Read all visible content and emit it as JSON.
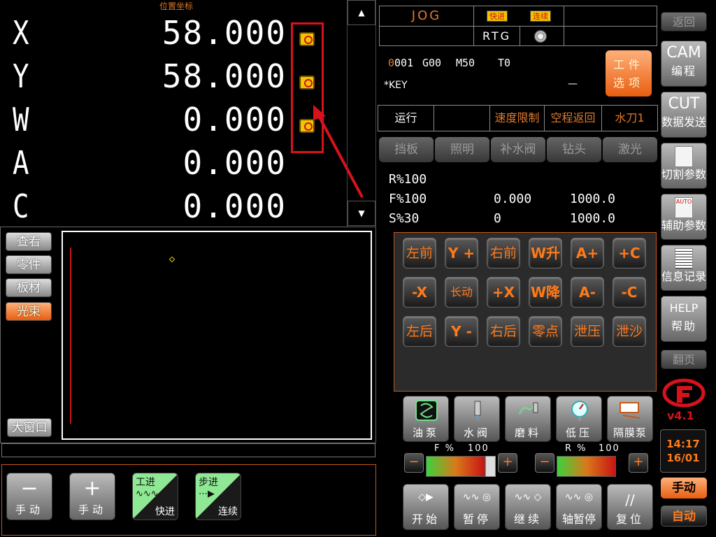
{
  "position": {
    "title": "位置坐标",
    "axes": [
      {
        "label": "X",
        "value": "58.000"
      },
      {
        "label": "Y",
        "value": "58.000"
      },
      {
        "label": "W",
        "value": "0.000"
      },
      {
        "label": "A",
        "value": "0.000"
      },
      {
        "label": "C",
        "value": "0.000"
      }
    ]
  },
  "scroll": {
    "up": "▲",
    "down": "▼"
  },
  "view_buttons": [
    "查看",
    "零件",
    "板材",
    "光束"
  ],
  "large_window": "大窗口",
  "bottom_buttons": {
    "minus_sym": "−",
    "minus_label": "手动",
    "plus_sym": "+",
    "plus_label": "手动",
    "feed_top": "工进",
    "feed_bottom": "快进",
    "step_top": "步进",
    "step_bottom": "连续"
  },
  "status": {
    "mode": "JOG",
    "tag_fast": "快进",
    "tag_continuous": "连续",
    "rtg": "RTG",
    "codes": {
      "n": "001",
      "g": "G00",
      "m": "M50",
      "t": "T0"
    },
    "key": "*KEY",
    "dash": "—"
  },
  "work_options": {
    "line1": "工件",
    "line2": "选项"
  },
  "run_row": [
    "运行",
    "",
    "速度限制",
    "空程返回",
    "水刀1"
  ],
  "gray_buttons": [
    "挡板",
    "照明",
    "补水阀",
    "钻头",
    "激光"
  ],
  "overrides": {
    "r": "R%100",
    "f": "F%100",
    "s": "S%30",
    "f_val1": "0.000",
    "f_val2": "1000.0",
    "s_val1": "0",
    "s_val2": "1000.0"
  },
  "jog_rows": [
    [
      "左前",
      "Y +",
      "右前",
      "W升",
      "A+",
      "+C"
    ],
    [
      "-X",
      "长动",
      "+X",
      "W降",
      "A-",
      "-C"
    ],
    [
      "左后",
      "Y -",
      "右后",
      "零点",
      "泄压",
      "泄沙"
    ]
  ],
  "function_buttons": [
    "油泵",
    "水阀",
    "磨料",
    "低压",
    "隔膜泵"
  ],
  "feed_override": {
    "label": "F %",
    "value": "100",
    "level": 0.85
  },
  "rapid_override": {
    "label": "R %",
    "value": "100",
    "level": 0.85
  },
  "control_buttons": [
    {
      "icon": "◇▶",
      "label": "开始"
    },
    {
      "icon": "∿∿ ◎",
      "label": "暂停"
    },
    {
      "icon": "∿∿ ◇",
      "label": "继续"
    },
    {
      "icon": "∿∿ ◎",
      "label": "轴暂停"
    },
    {
      "icon": "//",
      "label": "复位"
    }
  ],
  "rail": {
    "back": "返回",
    "cam_top": "CAM",
    "cam_bottom": "编程",
    "cut_top": "CUT",
    "cut_bottom": "数据发送",
    "cut_params": "切割参数",
    "auto_tag": "AUTO",
    "aux_params": "辅助参数",
    "info": "信息记录",
    "help_top": "HELP",
    "help_bottom": "帮助",
    "page": "翻页",
    "version": "v4.1",
    "time": "14:17",
    "date": "16/01",
    "manual": "手动",
    "auto": "自动"
  },
  "colors": {
    "accent": "#e07a2a",
    "lock_frame": "#d8121c",
    "panel_border": "#c55a1a",
    "logo": "#d8121c"
  }
}
